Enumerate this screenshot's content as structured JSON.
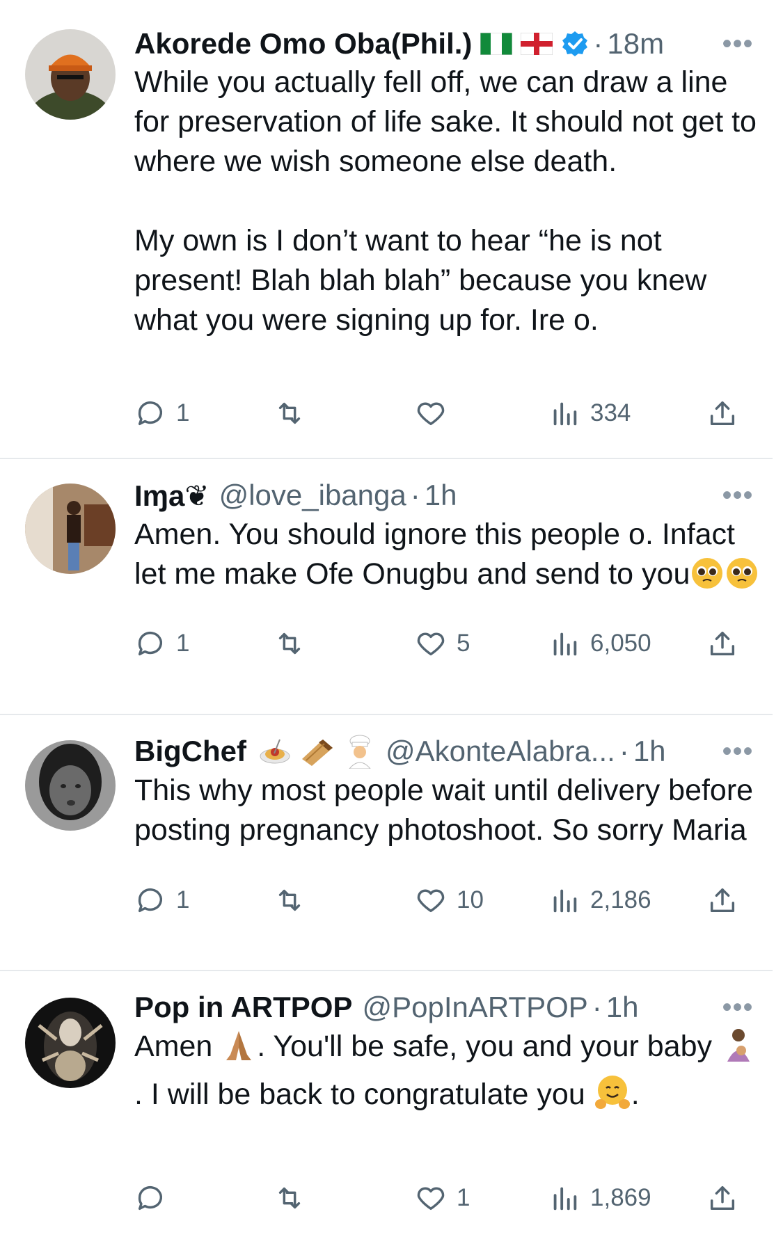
{
  "tweets": [
    {
      "name": "Akorede Omo Oba(Phil.)",
      "handle": "",
      "time": "18m",
      "body": "While you actually fell off, we can draw a line for preservation of life sake. It should not get to where we wish someone else death.\n\nMy own is I don’t want to hear “he is not present! Blah blah blah” because you knew what you were signing up for. Ire o.",
      "replies": "1",
      "retweets": "",
      "likes": "",
      "views": "334",
      "badges": [
        "nigeria-flag-icon",
        "england-flag-icon",
        "verified-badge-icon"
      ]
    },
    {
      "name": "Iɱa❦",
      "handle": "@love_ibanga",
      "time": "1h",
      "body_text": "Amen. You should ignore this people o. Infact let me make Ofe Onugbu and send to you",
      "body_emojis": [
        "pleading-face-emoji",
        "pleading-face-emoji"
      ],
      "replies": "1",
      "retweets": "",
      "likes": "5",
      "views": "6,050"
    },
    {
      "name": "BigChef",
      "name_emojis": [
        "spaghetti-emoji",
        "burrito-emoji",
        "cook-emoji"
      ],
      "handle": "@AkonteAlabra...",
      "time": "1h",
      "body": "This why most people wait until delivery before posting pregnancy photoshoot. So sorry Maria",
      "replies": "1",
      "retweets": "",
      "likes": "10",
      "views": "2,186"
    },
    {
      "name": "Pop in ARTPOP",
      "handle": "@PopInARTPOP",
      "time": "1h",
      "body_part1": "Amen",
      "body_part2": ". You'll be safe, you and your baby",
      "body_part3": ". I will be back to congratulate you",
      "body_part4": ".",
      "body_emojis": [
        "folded-hands-emoji",
        "breastfeeding-emoji",
        "hugging-face-emoji"
      ],
      "replies": "",
      "retweets": "",
      "likes": "1",
      "views": "1,869"
    }
  ],
  "ui": {
    "dot": "·",
    "more": "•••"
  },
  "colors": {
    "text": "#0f1419",
    "muted": "#536471",
    "verified": "#1d9bf0",
    "separator": "#e6e9ec"
  }
}
